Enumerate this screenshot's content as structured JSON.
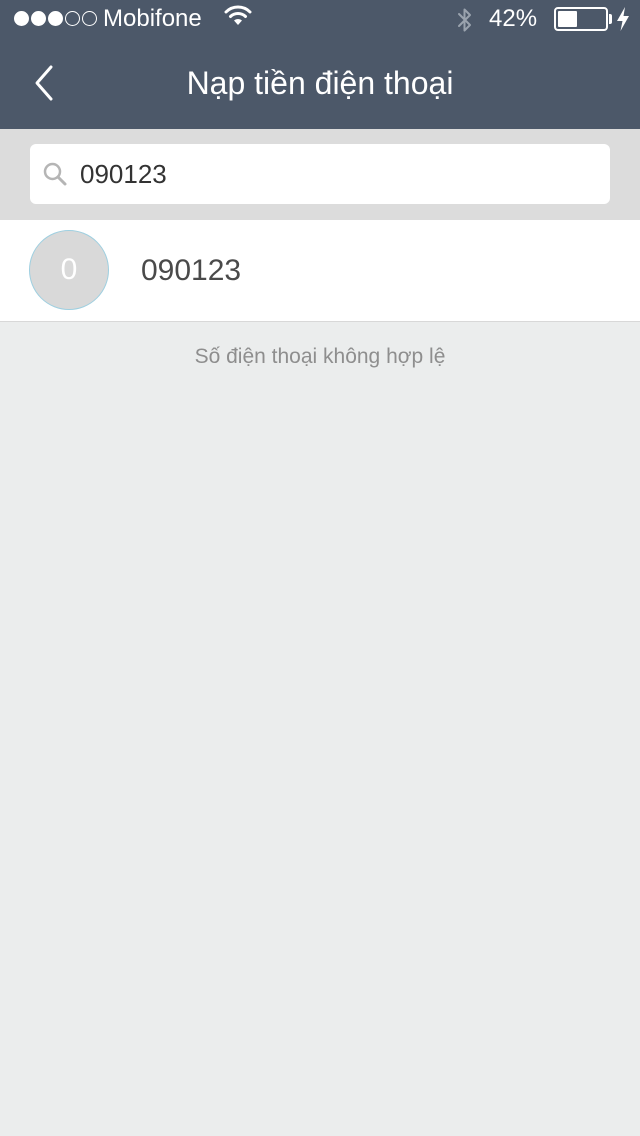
{
  "status_bar": {
    "signal_bars_filled": 3,
    "signal_bars_total": 5,
    "carrier": "Mobifone",
    "wifi_icon": "wifi-icon",
    "bluetooth_icon": "bluetooth-icon",
    "battery_percent": "42%",
    "battery_level": 0.42,
    "charging_icon": "bolt-icon"
  },
  "header": {
    "back_icon": "chevron-left-icon",
    "title": "Nạp tiền điện thoại"
  },
  "search": {
    "icon": "search-icon",
    "value": "090123"
  },
  "results": [
    {
      "avatar_initial": "0",
      "number": "090123"
    }
  ],
  "message": "Số điện thoại không hợp lệ",
  "colors": {
    "header_bg": "#4c5869",
    "search_bar_bg": "#dcdcdc",
    "page_bg": "#ebeded",
    "avatar_bg": "#d9d9d9",
    "message_text": "#8e8e8e"
  }
}
